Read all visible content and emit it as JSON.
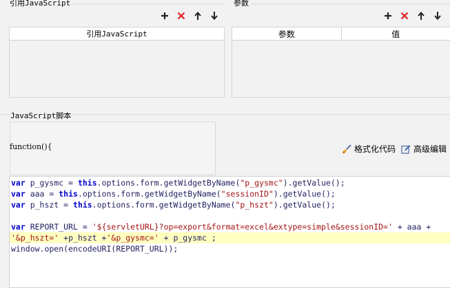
{
  "left_panel": {
    "section_label": "引用JavaScript",
    "column_header": "引用JavaScript"
  },
  "right_panel": {
    "section_label": "参数",
    "columns": [
      "参数",
      "值"
    ]
  },
  "toolbar_icons": [
    "add-icon",
    "delete-icon",
    "move-up-icon",
    "move-down-icon"
  ],
  "colors": {
    "delete": "#e02020",
    "highlight": "#ffffc0",
    "keyword": "#0000cc",
    "string": "#a31515"
  },
  "script_section": {
    "label": "JavaScript脚本",
    "function_header": "function(){",
    "format_label": "格式化代码",
    "advanced_label": "高级编辑"
  },
  "code": {
    "line1": {
      "k1": "var",
      "p1": " p_gysmc = ",
      "k2": "this",
      "p2": ".options.form.getWidgetByName(",
      "s1": "\"p_gysmc\"",
      "p3": ").getValue();"
    },
    "line2": {
      "k1": "var",
      "p1": " aaa = ",
      "k2": "this",
      "p2": ".options.form.getWidgetByName(",
      "s1": "\"sessionID\"",
      "p3": ").getValue();"
    },
    "line3": {
      "k1": "var",
      "p1": " p_hszt = ",
      "k2": "this",
      "p2": ".options.form.getWidgetByName(",
      "s1": "\"p_hszt\"",
      "p3": ").getValue();"
    },
    "line5": {
      "k1": "var",
      "p1": " REPORT_URL = ",
      "s1": "'${servletURL}?op=export&format=excel&extype=simple&sessionID='",
      "p2": " + aaa +"
    },
    "line6": {
      "s1": "'&p_hszt='",
      "p1": " +p_hszt +",
      "s2": "'&p_gysmc='",
      "p2": " + p_gysmc ;"
    },
    "line7": {
      "p1": "window.open(encodeURI(REPORT_URL));"
    }
  }
}
